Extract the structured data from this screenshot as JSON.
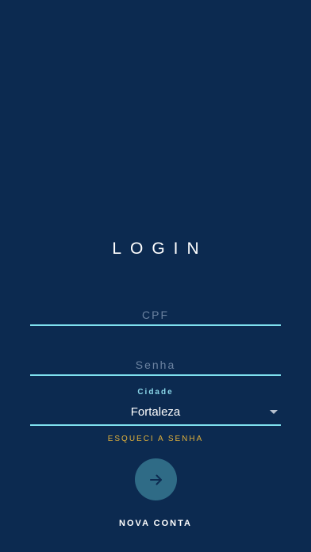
{
  "login": {
    "title": "LOGIN",
    "cpf": {
      "placeholder": "CPF",
      "value": ""
    },
    "senha": {
      "placeholder": "Senha",
      "value": ""
    },
    "cidade": {
      "label": "Cidade",
      "selected": "Fortaleza"
    },
    "forgot_password": "ESQUECI A SENHA",
    "submit_icon": "arrow-right-icon",
    "new_account": "NOVA CONTA"
  },
  "colors": {
    "background": "#0c2a50",
    "underline": "#7fe1ef",
    "label_accent": "#8ad6e8",
    "forgot_link": "#e0b03a",
    "submit_button": "#2f6b86"
  }
}
